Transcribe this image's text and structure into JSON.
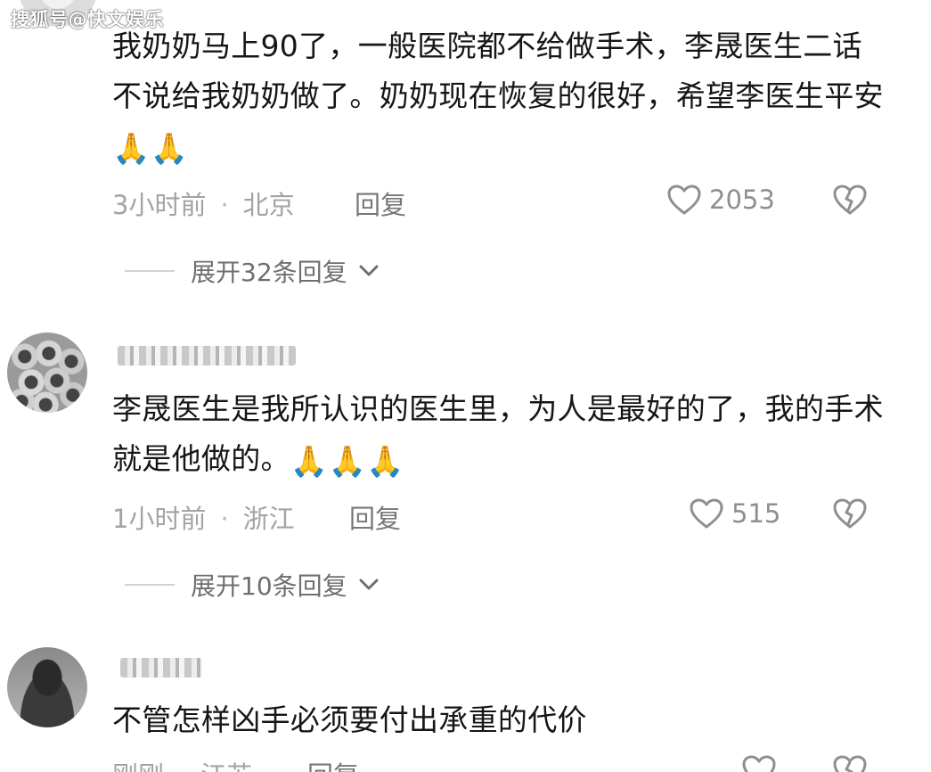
{
  "watermark": {
    "text": "搜狐号@快文娱乐"
  },
  "comments": [
    {
      "text": "我奶奶马上90了，一般医院都不给做手术，李晟医生二话不说给我奶奶做了。奶奶现在恢复的很好，希望李医生平安",
      "emoji": "🙏🙏",
      "time": "3小时前",
      "location": "北京",
      "reply_label": "回复",
      "likes": "2053",
      "expand_label": "展开32条回复"
    },
    {
      "text": "李晟医生是我所认识的医生里，为人是最好的了，我的手术就是他做的。",
      "emoji": "🙏🙏🙏",
      "time": "1小时前",
      "location": "浙江",
      "reply_label": "回复",
      "likes": "515",
      "expand_label": "展开10条回复"
    },
    {
      "text": "不管怎样凶手必须要付出承重的代价",
      "time": "刚刚",
      "location": "江苏",
      "reply_label": "回复"
    }
  ],
  "icons": {
    "like": "heart-outline-icon",
    "dislike": "broken-heart-icon",
    "expand": "chevron-down-icon"
  },
  "colors": {
    "text": "#161616",
    "meta": "#a3a3a3",
    "reply": "#777777"
  }
}
